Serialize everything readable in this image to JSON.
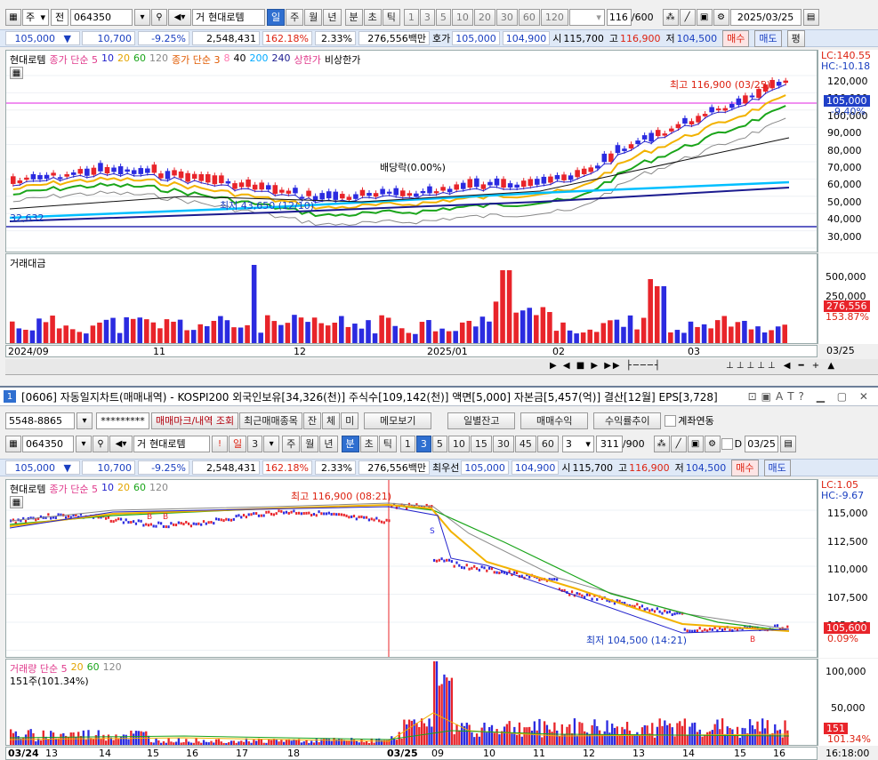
{
  "top": {
    "toolbar": {
      "market": "주",
      "type": "전",
      "code": "064350",
      "name": "현대로템",
      "periods": [
        "일",
        "주",
        "월",
        "년"
      ],
      "active_period": "일",
      "intraday": [
        "분",
        "초",
        "틱"
      ],
      "nums": [
        "1",
        "3",
        "5",
        "10",
        "20",
        "30",
        "60",
        "120"
      ],
      "count": "116",
      "count_total": "/600",
      "date": "2025/03/25"
    },
    "info": {
      "price": "105,000",
      "change_arrow": "▼",
      "change": "10,700",
      "pct": "-9.25%",
      "volume": "2,548,431",
      "vol_ratio": "162.18%",
      "turnover": "2.33%",
      "amount": "276,556백만",
      "quote_label": "호가",
      "bid": "105,000",
      "ask": "104,900",
      "open_label": "시",
      "open": "115,700",
      "high_label": "고",
      "high": "116,900",
      "low_label": "저",
      "low": "104,500",
      "buy": "매수",
      "sell": "매도",
      "eval": "평"
    },
    "legend": {
      "name": "현대로템",
      "ma1_label": "종가 단순 5",
      "ma1_vals": [
        "10",
        "20",
        "60",
        "120"
      ],
      "ma2_label": "종가 단순 3",
      "ma2_vals": [
        "8",
        "40",
        "200",
        "240"
      ],
      "upper": "상한가",
      "nonupper": "비상한가"
    },
    "annotations": {
      "high": "최고 116,900 (03/25)",
      "low": "최저 43,650 (12/10)",
      "dividend": "배당락(0.00%)",
      "level": "32,632"
    },
    "y_labels": [
      "120,000",
      "110,000",
      "100,000",
      "90,000",
      "80,000",
      "70,000",
      "60,000",
      "50,000",
      "40,000",
      "30,000"
    ],
    "lc": "LC:140.55",
    "hc": "HC:-10.18",
    "cur_price": "105,000",
    "cur_pct": "-9.40%",
    "vol_title": "거래대금",
    "vol_y": [
      "500,000",
      "250,000"
    ],
    "vol_cur": "276,556",
    "vol_cur_pct": "153.87%",
    "x_labels": [
      "2024/09",
      "11",
      "12",
      "2025/01",
      "02",
      "03"
    ],
    "x_right": "03/25"
  },
  "bottom": {
    "window_title": "[0606] 자동일지차트(매매내역) - KOSPI200 외국인보유[34,326(천)] 주식수[109,142(천)] 액면[5,000] 자본금[5,457(억)] 결산[12월] EPS[3,728]",
    "window_num": "1",
    "acct": {
      "account": "5548-8865",
      "password": "*********",
      "mark_btn": "매매마크/내역 조회",
      "recent": "최근매매종목",
      "ja": "잔",
      "che": "체",
      "mi": "미",
      "memo": "메모보기",
      "daily": "일별잔고",
      "profit": "매매수익",
      "yield": "수익률추이",
      "acct_link": "계좌연동"
    },
    "toolbar": {
      "code": "064350",
      "name": "현대로템",
      "periods": [
        "일",
        "주",
        "월",
        "년"
      ],
      "active_period": "분",
      "day_num": "3",
      "intraday": [
        "분",
        "초",
        "틱"
      ],
      "nums": [
        "1",
        "3",
        "5",
        "10",
        "15",
        "30",
        "45",
        "60"
      ],
      "active_num": "3",
      "sel": "3",
      "count": "311",
      "count_total": "/900",
      "d_label": "D",
      "date": "03/25"
    },
    "info": {
      "price": "105,000",
      "change_arrow": "▼",
      "change": "10,700",
      "pct": "-9.25%",
      "volume": "2,548,431",
      "vol_ratio": "162.18%",
      "turnover": "2.33%",
      "amount": "276,556백만",
      "quote_label": "최우선",
      "bid": "105,000",
      "ask": "104,900",
      "open_label": "시",
      "open": "115,700",
      "high_label": "고",
      "high": "116,900",
      "low_label": "저",
      "low": "104,500",
      "buy": "매수",
      "sell": "매도"
    },
    "legend": {
      "name": "현대로템",
      "ma_label": "종가 단순 5",
      "ma_vals": [
        "10",
        "20",
        "60",
        "120"
      ]
    },
    "annotations": {
      "high": "최고 116,900 (08:21)",
      "low": "최저 104,500 (14:21)"
    },
    "y_labels": [
      "115,000",
      "112,500",
      "110,000",
      "107,500",
      "105,000"
    ],
    "lc": "LC:1.05",
    "hc": "HC:-9.67",
    "cur_price": "105,600",
    "cur_pct": "0.09%",
    "vol_title": "거래량 단순 5",
    "vol_ma": [
      "20",
      "60",
      "120"
    ],
    "vol_sub": "151주(101.34%)",
    "vol_y": [
      "100,000",
      "50,000"
    ],
    "vol_cur": "151",
    "vol_cur_pct": "101.34%",
    "x_labels": [
      "03/24",
      "13",
      "14",
      "15",
      "16",
      "17",
      "18",
      "03/25",
      "09",
      "10",
      "11",
      "12",
      "13",
      "14",
      "15",
      "16"
    ],
    "x_right": "16:18:00"
  },
  "colors": {
    "up": "#e8242a",
    "down": "#2b2be0",
    "ma5": "#ff4fa0",
    "ma10": "#2222cc",
    "ma20": "#f2b200",
    "ma60": "#1aa51a",
    "ma120": "#888888",
    "ma200": "#00bfff",
    "ma240": "#1b1b8f",
    "accent": "#2f6fd0"
  }
}
